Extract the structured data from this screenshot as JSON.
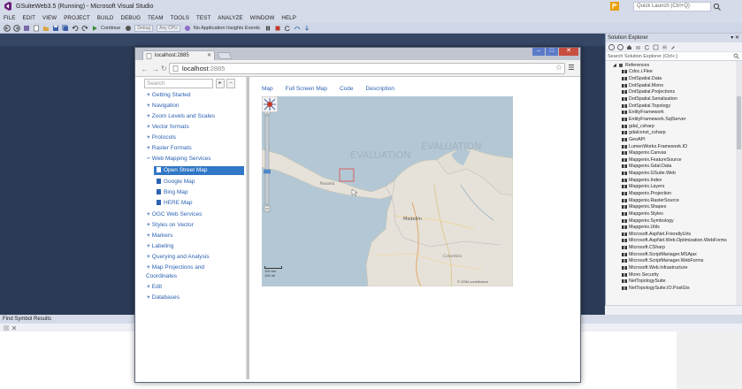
{
  "vs": {
    "title": "GSuiteWeb3.5 (Running) - Microsoft Visual Studio",
    "quick_launch_placeholder": "Quick Launch (Ctrl+Q)",
    "menu": [
      "FILE",
      "EDIT",
      "VIEW",
      "PROJECT",
      "BUILD",
      "DEBUG",
      "TEAM",
      "TOOLS",
      "TEST",
      "ANALYZE",
      "WINDOW",
      "HELP"
    ],
    "toolbar": {
      "continue_label": "Continue",
      "config_label": "Debug",
      "platform_label": "Any CPU",
      "insights_label": "No Application Insights Events"
    }
  },
  "solution_explorer": {
    "title": "Solution Explorer",
    "search_placeholder": "Search Solution Explorer (Ctrl+;)",
    "references_label": "References",
    "references": [
      "Cdoc.i.Flee",
      "DotSpatial.Data",
      "DotSpatial.Mono",
      "DotSpatial.Projections",
      "DotSpatial.Serialization",
      "DotSpatial.Topology",
      "EntityFramework",
      "EntityFramework.SqlServer",
      "gdal_csharp",
      "gdalconst_csharp",
      "GeoAPI",
      "LumenWorks.Framework.IO",
      "Mapgenix.Canvas",
      "Mapgenix.FeatureSource",
      "Mapgenix.Gdal.Data",
      "Mapgenix.GSuite.Web",
      "Mapgenix.Index",
      "Mapgenix.Layers",
      "Mapgenix.Projection",
      "Mapgenix.RasterSource",
      "Mapgenix.Shapes",
      "Mapgenix.Styles",
      "Mapgenix.Symbology",
      "Mapgenix.Utils",
      "Microsoft.AspNet.FriendlyUrls",
      "Microsoft.AspNet.Web.Optimization.WebForms",
      "Microsoft.CSharp",
      "Microsoft.ScriptManager.MSAjax",
      "Microsoft.ScriptManager.WebForms",
      "Microsoft.Web.Infrastructure",
      "Mono.Security",
      "NetTopologySuite",
      "NetTopologySuite.IO.PostGis"
    ]
  },
  "find_symbol": {
    "title": "Find Symbol Results"
  },
  "browser": {
    "tab_title": "localhost:2885",
    "url_host": "localhost",
    "url_port": ":2885",
    "search_placeholder": "Search",
    "nav": [
      "Getting Started",
      "Navigation",
      "Zoom Levels and Scales",
      "Vector formats",
      "Protocols",
      "Raster Formats",
      "Web Mapping Services",
      "OGC Web Services",
      "Styles on Vector",
      "Markers",
      "Labeling",
      "Querying and Analysis",
      "Map Projections and",
      "Coordinates",
      "Edit",
      "Databases"
    ],
    "sub": [
      "Open Street Map",
      "Google Map",
      "Bing Map",
      "HERE Map"
    ],
    "map_tabs": [
      "Map",
      "Full Screen Map",
      "Code",
      "Description"
    ],
    "map": {
      "watermark": "EVALUATION",
      "city_medellin": "Medellín",
      "city_panama": "Panamá",
      "country_colombia": "Colombia",
      "scale_km": "100 km",
      "scale_mi": "100 mi",
      "credit": "© OSM contributors"
    }
  },
  "colors": {
    "vs_chrome": "#d6dbe9",
    "vs_editor": "#2b3a55",
    "link": "#2c62b2",
    "selected": "#3077c6",
    "map_water": "#afc5d1",
    "map_land": "#e6e2d9"
  }
}
